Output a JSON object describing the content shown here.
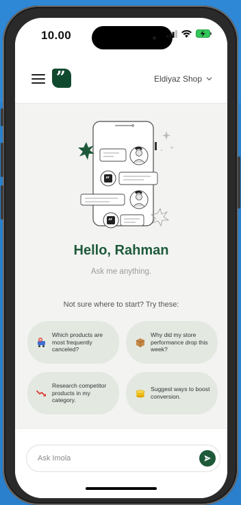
{
  "status_bar": {
    "time": "10.00"
  },
  "header": {
    "shop_name": "Eldiyaz Shop"
  },
  "main": {
    "greeting": "Hello, Rahman",
    "subtitle": "Ask me anything.",
    "prompt_intro": "Not sure where to start? Try these:",
    "suggestions": [
      {
        "text": "Which products are most frequently canceled?",
        "icon": "cart-cancel-icon"
      },
      {
        "text": "Why did my store performance drop this week?",
        "icon": "box-icon"
      },
      {
        "text": "Research competitor products in my category.",
        "icon": "trend-down-icon"
      },
      {
        "text": "Suggest ways to boost conversion.",
        "icon": "coins-icon"
      }
    ]
  },
  "composer": {
    "placeholder": "Ask Imola"
  },
  "colors": {
    "brand_green": "#1e5a3a",
    "background_blue": "#2d86d4",
    "card_bg": "#e3e8e1"
  }
}
